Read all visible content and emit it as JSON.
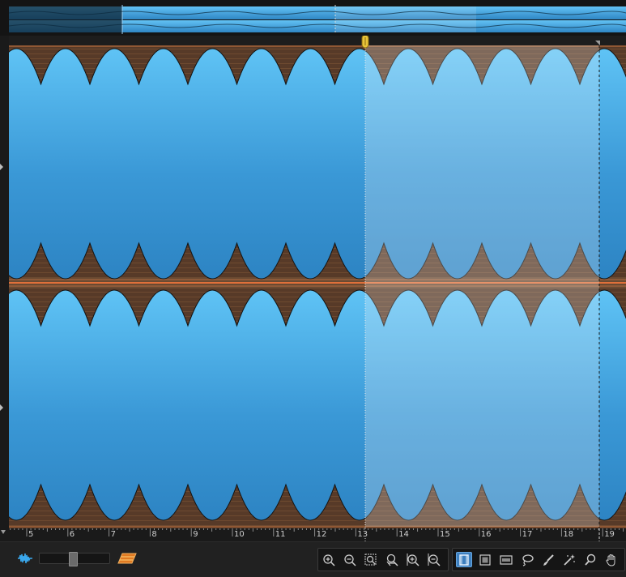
{
  "colors": {
    "waveform_blue": "#44a9e6",
    "waveform_brown": "#5a3a28",
    "selection_tint": "#ffffff",
    "playhead_marker": "#e8c43a",
    "ruler_text": "#cfcfcf"
  },
  "ruler": {
    "labels": [
      "5",
      "6",
      "7",
      "8",
      "9",
      "10",
      "11",
      "12",
      "13",
      "14",
      "15",
      "16",
      "17",
      "18",
      "19"
    ]
  },
  "editor": {
    "channels": [
      "left",
      "right"
    ],
    "selection_start_label": "13",
    "selection_end_label": "19"
  },
  "bottom_bar": {
    "left_icons": [
      "waveform-icon",
      "spectral-icon"
    ],
    "zoom_tools": [
      "zoom-in-icon",
      "zoom-out-icon",
      "zoom-selection-icon",
      "zoom-reset-icon",
      "zoom-in-vertical-icon",
      "zoom-out-vertical-icon"
    ],
    "selection_tools": [
      "time-selection-icon",
      "rectangle-selection-icon",
      "frequency-selection-icon",
      "lasso-icon",
      "brush-icon",
      "magic-wand-icon",
      "magnify-icon",
      "hand-icon"
    ],
    "active_tool": "time-selection-icon"
  }
}
